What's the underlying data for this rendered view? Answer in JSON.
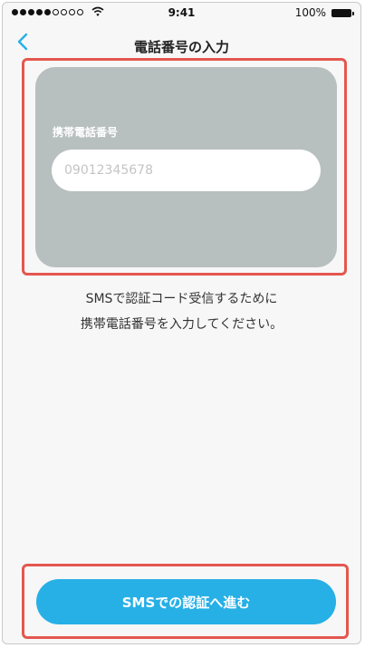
{
  "status_bar": {
    "time": "9:41",
    "battery_percent": "100%",
    "signal_bars_filled": 5,
    "signal_bars_total": 9,
    "icons": [
      "wifi-icon",
      "battery-icon"
    ]
  },
  "nav": {
    "title": "電話番号の入力",
    "back_icon": "chevron-left-icon"
  },
  "form": {
    "phone_label": "携帯電話番号",
    "phone_placeholder": "09012345678",
    "phone_value": ""
  },
  "instruction": {
    "line1": "SMSで認証コード受信するために",
    "line2": "携帯電話番号を入力してください。"
  },
  "actions": {
    "submit_label": "SMSでの認証へ進む"
  },
  "colors": {
    "accent": "#27b0e6",
    "card_bg": "#b8bfbf",
    "highlight": "#e4574f",
    "page_bg": "#f7f7f7"
  }
}
